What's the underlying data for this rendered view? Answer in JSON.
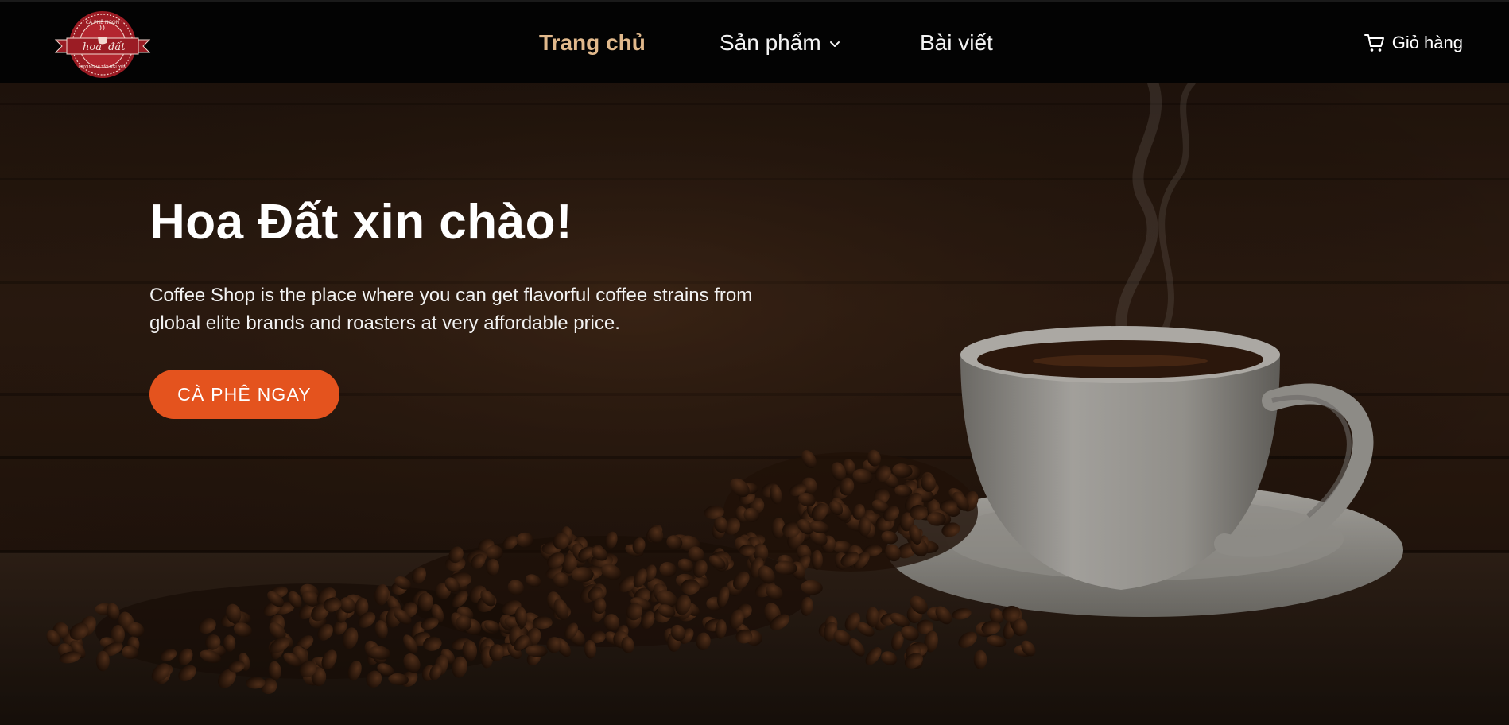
{
  "brand": {
    "logo_top_text": "CÀ PHÊ NGON",
    "logo_left": "hoa",
    "logo_right": "đất",
    "logo_bottom_text": "HƯƠNG VỊ TÂY NGUYÊN"
  },
  "nav": {
    "items": [
      {
        "label": "Trang chủ",
        "active": true
      },
      {
        "label": "Sản phẩm",
        "has_dropdown": true,
        "icon": "chevron-down-icon"
      },
      {
        "label": "Bài viết"
      }
    ],
    "cart": {
      "label": "Giỏ hàng",
      "icon": "cart-icon"
    }
  },
  "hero": {
    "title": "Hoa Đất xin chào!",
    "description": "Coffee Shop is the place where you can get flavorful coffee strains from global elite brands and roasters at very affordable price.",
    "cta_label": "CÀ PHÊ NGAY",
    "background": "coffee-cup-with-beans-photo"
  },
  "colors": {
    "nav_bg": "#030303",
    "active_link": "#e1b98c",
    "cta": "#e4531e",
    "logo_red": "#9b1c24"
  }
}
